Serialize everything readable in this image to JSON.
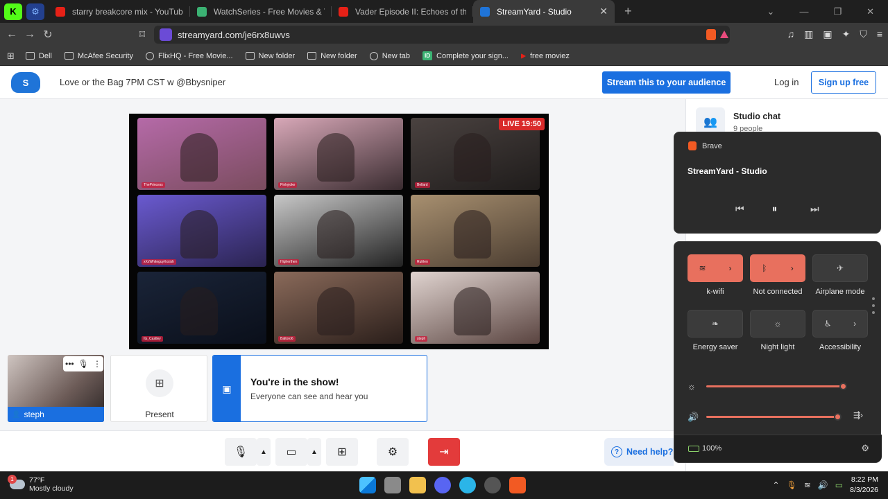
{
  "browser": {
    "tabs": [
      {
        "title": "starry breakcore mix - YouTube",
        "favicon": "youtube-icon",
        "color": "#e62117"
      },
      {
        "title": "WatchSeries - Free Movies & TV Shows",
        "favicon": "play-icon",
        "color": "#3bb273"
      },
      {
        "title": "Vader Episode II: Echoes of the Jedi",
        "favicon": "youtube-icon",
        "color": "#e62117"
      },
      {
        "title": "StreamYard - Studio",
        "favicon": "streamyard-icon",
        "color": "#1f74d8"
      }
    ],
    "new_tab": "+",
    "url": "streamyard.com/je6rx8uwvs",
    "bookmarks": [
      {
        "label": "Dell",
        "icon": "folder-icon"
      },
      {
        "label": "McAfee Security",
        "icon": "folder-icon"
      },
      {
        "label": "FlixHQ - Free Movie...",
        "icon": "globe-icon"
      },
      {
        "label": "New folder",
        "icon": "folder-icon"
      },
      {
        "label": "New folder",
        "icon": "folder-icon"
      },
      {
        "label": "New tab",
        "icon": "globe-icon"
      },
      {
        "label": "Complete your sign...",
        "icon": "id-icon"
      },
      {
        "label": "free moviez",
        "icon": "youtube-icon"
      }
    ],
    "id_badge": "ID"
  },
  "app": {
    "logo_text": "S",
    "show_title": "Love or the Bag 7PM CST w @Bbysniper",
    "stream_button": "Stream this to your audience",
    "login": "Log in",
    "signup": "Sign up free",
    "live_badge": "LIVE 19:50",
    "tiles": [
      {
        "name": "ThePrincess",
        "colors": [
          "#b56aa8",
          "#7a4c5e"
        ]
      },
      {
        "name": "Pinkyjoke",
        "colors": [
          "#d8a8b8",
          "#3a2c30"
        ]
      },
      {
        "name": "Bellard",
        "colors": [
          "#4a4240",
          "#1f1c1b"
        ]
      },
      {
        "name": "xXxWhiteguyXxxish",
        "colors": [
          "#6a5ad0",
          "#2a2350"
        ]
      },
      {
        "name": "Higherthen",
        "colors": [
          "#c8c8c8",
          "#222"
        ]
      },
      {
        "name": "Ruhlen",
        "colors": [
          "#a89070",
          "#4a3c30"
        ]
      },
      {
        "name": "Its_Castley",
        "colors": [
          "#1a2438",
          "#0a0f1a"
        ]
      },
      {
        "name": "Baltoro6",
        "colors": [
          "#8a6a5a",
          "#2a1e1a"
        ]
      },
      {
        "name": "steph",
        "colors": [
          "#e0d4d0",
          "#5a4440"
        ]
      }
    ],
    "self_name": "steph",
    "present_label": "Present",
    "in_show_title": "You're in the show!",
    "in_show_sub": "Everyone can see and hear you",
    "help": "Need help?",
    "chat_title": "Studio chat",
    "chat_count": "9 people"
  },
  "media_flyout": {
    "app": "Brave",
    "title": "StreamYard - Studio"
  },
  "quick_settings": {
    "tiles": [
      {
        "label": "k-wifi",
        "state": "on",
        "icon": "wifi-icon",
        "glyph": "≋"
      },
      {
        "label": "Not connected",
        "state": "on",
        "icon": "bluetooth-icon",
        "glyph": "ᛒ"
      },
      {
        "label": "Airplane mode",
        "state": "off",
        "icon": "airplane-icon",
        "glyph": "✈"
      },
      {
        "label": "Energy saver",
        "state": "off",
        "icon": "leaf-icon",
        "glyph": "❧"
      },
      {
        "label": "Night light",
        "state": "off",
        "icon": "sun-icon",
        "glyph": "☼"
      },
      {
        "label": "Accessibility",
        "state": "off",
        "icon": "accessibility-icon",
        "glyph": "♿"
      }
    ],
    "brightness": 0.99,
    "volume": 0.95,
    "battery": "100%",
    "accent": "#e8705e"
  },
  "taskbar": {
    "weather_temp": "77°F",
    "weather_desc": "Mostly cloudy",
    "weather_badge": "1",
    "time": "8:22 PM",
    "date": "8/3/2026"
  }
}
